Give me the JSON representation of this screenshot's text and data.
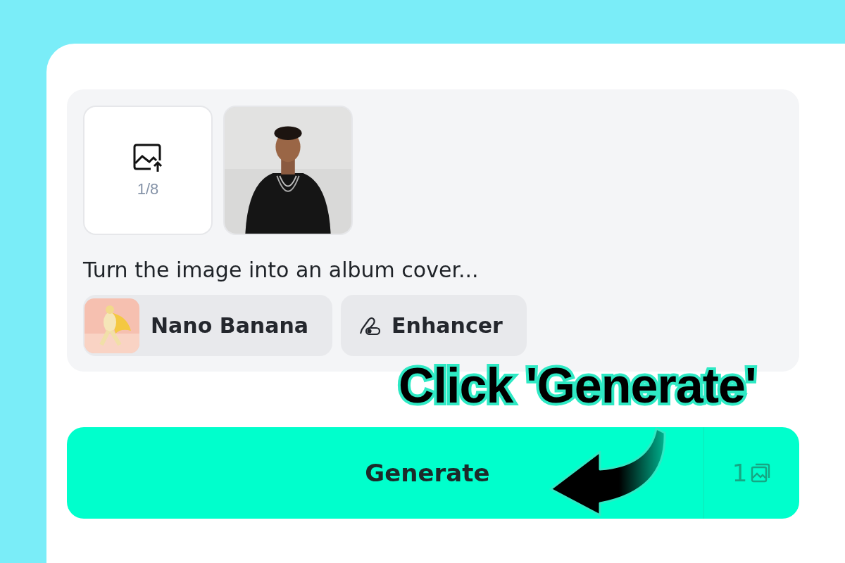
{
  "upload_tile": {
    "counter": "1/8"
  },
  "prompt": "Turn the image into an album cover...",
  "chips": [
    {
      "kind": "model",
      "label": "Nano Banana"
    },
    {
      "kind": "tool",
      "label": "Enhancer"
    }
  ],
  "generate_button": {
    "label": "Generate",
    "cost": "1"
  },
  "annotation": {
    "text": "Click 'Generate'"
  }
}
